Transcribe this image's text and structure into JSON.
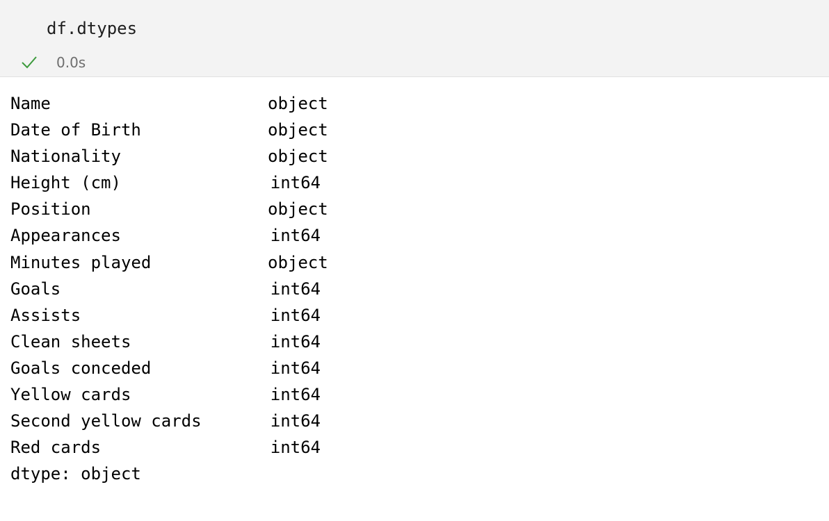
{
  "cell": {
    "code": "df.dtypes",
    "exec_time": "0.0s",
    "status_icon": "check-icon",
    "status_color": "#3c9a3c"
  },
  "output": {
    "rows": [
      {
        "name": "Name",
        "dtype": "object"
      },
      {
        "name": "Date of Birth",
        "dtype": "object"
      },
      {
        "name": "Nationality",
        "dtype": "object"
      },
      {
        "name": "Height (cm)",
        "dtype": "int64"
      },
      {
        "name": "Position",
        "dtype": "object"
      },
      {
        "name": "Appearances",
        "dtype": "int64"
      },
      {
        "name": "Minutes played",
        "dtype": "object"
      },
      {
        "name": "Goals",
        "dtype": "int64"
      },
      {
        "name": "Assists",
        "dtype": "int64"
      },
      {
        "name": "Clean sheets",
        "dtype": "int64"
      },
      {
        "name": "Goals conceded",
        "dtype": "int64"
      },
      {
        "name": "Yellow cards",
        "dtype": "int64"
      },
      {
        "name": "Second yellow cards",
        "dtype": "int64"
      },
      {
        "name": "Red cards",
        "dtype": "int64"
      }
    ],
    "footer": "dtype: object"
  }
}
